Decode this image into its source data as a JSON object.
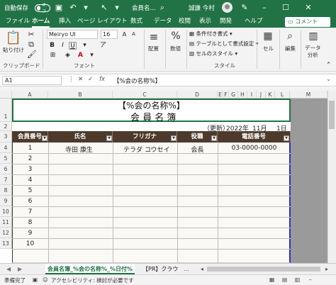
{
  "titlebar": {
    "autosave_label": "自動保存",
    "autosave_state": "オフ",
    "filename": "会員名...",
    "user_name": "誠謙 今村"
  },
  "tabs": [
    "ファイル",
    "ホーム",
    "挿入",
    "ページ レイアウト",
    "数式",
    "データ",
    "校閲",
    "表示",
    "開発",
    "ヘルプ"
  ],
  "active_tab": "ホーム",
  "comment_label": "コメント",
  "ribbon": {
    "paste_label": "貼り付け",
    "clipboard_label": "クリップボード",
    "font_name": "Meiryo UI",
    "font_size": "16",
    "font_group_label": "フォント",
    "alignment_label": "配置",
    "number_label": "数値",
    "conditional_format": "条件付き書式",
    "table_format": "テーブルとして書式設定",
    "cell_style": "セルのスタイル",
    "style_group_label": "スタイル",
    "cells_label": "セル",
    "editing_label": "編集",
    "data_analysis_label": "データ\n分析"
  },
  "formula_bar": {
    "name_box": "A1",
    "fx": "fx",
    "formula": "【%会の名称%】"
  },
  "columns": [
    "A",
    "B",
    "C",
    "D",
    "E",
    "F",
    "G",
    "H",
    "I",
    "J",
    "K",
    "L",
    "M"
  ],
  "rows": [
    "1",
    "2",
    "3",
    "4",
    "5",
    "6",
    "7",
    "8",
    "9",
    "10",
    "11",
    "12",
    "13"
  ],
  "sheet": {
    "title_line1": "【%会の名称%】",
    "title_line2": "会 員 名 簿",
    "updated_label": "（更新）",
    "year": "2022年",
    "month": "11月",
    "day": "1日",
    "headers": [
      "会員番号",
      "氏名",
      "フリガナ",
      "役職",
      "電話番号"
    ],
    "records": [
      {
        "no": "1",
        "name": "寺田 康生",
        "kana": "テラダ コウセイ",
        "role": "会長",
        "tel": "03-0000-0000"
      },
      {
        "no": "2",
        "name": "",
        "kana": "",
        "role": "",
        "tel": ""
      },
      {
        "no": "3",
        "name": "",
        "kana": "",
        "role": "",
        "tel": ""
      },
      {
        "no": "4",
        "name": "",
        "kana": "",
        "role": "",
        "tel": ""
      },
      {
        "no": "5",
        "name": "",
        "kana": "",
        "role": "",
        "tel": ""
      },
      {
        "no": "6",
        "name": "",
        "kana": "",
        "role": "",
        "tel": ""
      },
      {
        "no": "7",
        "name": "",
        "kana": "",
        "role": "",
        "tel": ""
      },
      {
        "no": "8",
        "name": "",
        "kana": "",
        "role": "",
        "tel": ""
      },
      {
        "no": "9",
        "name": "",
        "kana": "",
        "role": "",
        "tel": ""
      },
      {
        "no": "10",
        "name": "",
        "kana": "",
        "role": "",
        "tel": ""
      }
    ]
  },
  "sheet_tabs": [
    "会員名簿_%会の名称%_%日付%",
    "【PR】クラウ"
  ],
  "statusbar": {
    "ready": "準備完了",
    "accessibility": "アクセシビリティ: 検討が必要です"
  }
}
